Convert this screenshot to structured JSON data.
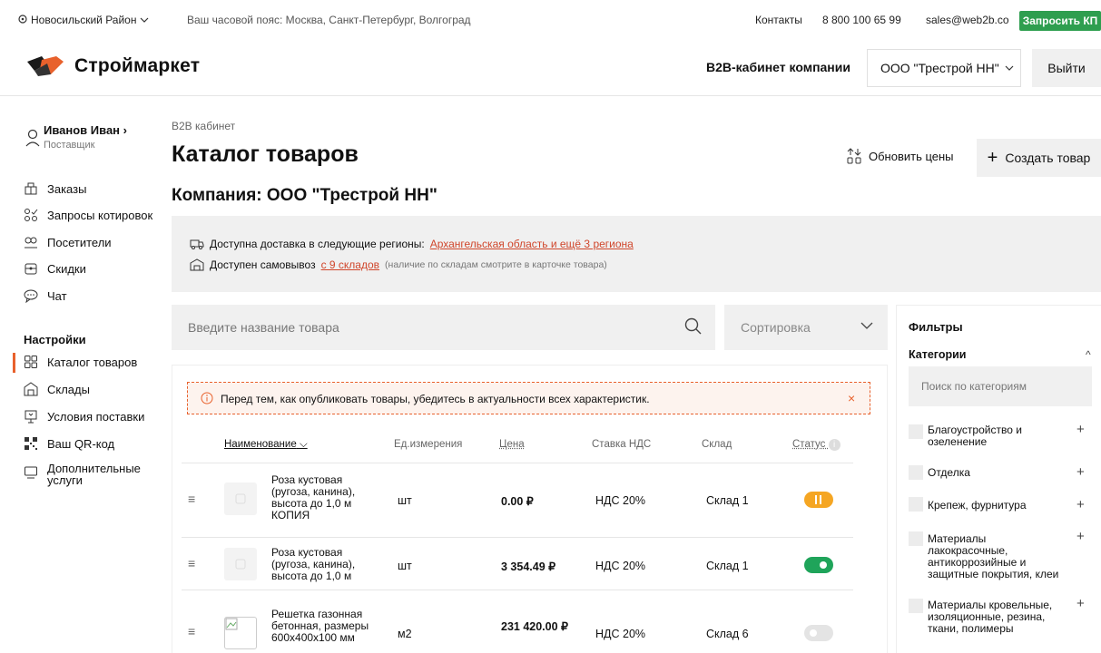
{
  "topbar": {
    "region": "Новосильский Район",
    "timezone": "Ваш часовой пояс: Москва, Санкт-Петербург, Волгоград",
    "contacts": "Контакты",
    "phone": "8 800 100 65 99",
    "email": "sales@web2b.co",
    "request_kp": "Запросить КП"
  },
  "header": {
    "logo_text": "Строймаркет",
    "b2b_label": "B2B-кабинет компании",
    "company_select": "ООО \"Трестрой НН\"",
    "logout": "Выйти"
  },
  "sidebar": {
    "user_name": "Иванов Иван",
    "user_role": "Поставщик",
    "items": [
      {
        "label": "Заказы",
        "icon": "orders-icon"
      },
      {
        "label": "Запросы котировок",
        "icon": "quotes-icon"
      },
      {
        "label": "Посетители",
        "icon": "visitors-icon"
      },
      {
        "label": "Скидки",
        "icon": "discount-icon"
      },
      {
        "label": "Чат",
        "icon": "chat-icon"
      }
    ],
    "settings_title": "Настройки",
    "settings_items": [
      {
        "label": "Каталог товаров",
        "icon": "catalog-icon",
        "active": true
      },
      {
        "label": "Склады",
        "icon": "warehouse-icon"
      },
      {
        "label": "Условия поставки",
        "icon": "delivery-terms-icon"
      },
      {
        "label": "Ваш QR-код",
        "icon": "qr-icon"
      },
      {
        "label": "Дополнительные услуги",
        "icon": "services-icon"
      }
    ]
  },
  "main": {
    "breadcrumb": "B2B кабинет",
    "title": "Каталог товаров",
    "company_title": "Компания: ООО \"Трестрой НН\"",
    "update_prices": "Обновить цены",
    "create_product": "Создать товар",
    "info": {
      "delivery_prefix": "Доступна доставка в следующие регионы:",
      "delivery_link": "Архангельская область и ещё 3 региона",
      "pickup_prefix": "Доступен самовывоз",
      "pickup_link": "с 9 складов",
      "pickup_note": "(наличие по складам смотрите в карточке товара)"
    },
    "search_placeholder": "Введите название товара",
    "sort_label": "Сортировка",
    "alert": "Перед тем, как опубликовать товары, убедитесь в актуальности всех характеристик.",
    "columns": {
      "name": "Наименование",
      "unit": "Ед.измерения",
      "price": "Цена",
      "vat": "Ставка НДС",
      "warehouse": "Склад",
      "status": "Статус"
    },
    "rows": [
      {
        "name": "Роза кустовая (ругоза, канина), высота до 1,0 м КОПИЯ",
        "unit": "шт",
        "price": "0.00 ₽",
        "vat": "НДС 20%",
        "warehouse": "Склад 1",
        "status": "paused"
      },
      {
        "name": "Роза кустовая (ругоза, канина), высота до 1,0 м",
        "unit": "шт",
        "price": "3 354.49 ₽",
        "vat": "НДС 20%",
        "warehouse": "Склад 1",
        "status": "on"
      },
      {
        "name": "Решетка газонная бетонная, размеры 600х400х100 мм",
        "unit": "м2",
        "price": "231 420.00 ₽",
        "vat": "НДС 20%",
        "warehouse": "Склад 6",
        "status": "off"
      }
    ]
  },
  "filters": {
    "title": "Фильтры",
    "categories_title": "Категории",
    "category_search_placeholder": "Поиск по категориям",
    "categories": [
      "Благоустройство и озеленение",
      "Отделка",
      "Крепеж, фурнитура",
      "Материалы лакокрасочные, антикоррозийные и защитные покрытия, клеи",
      "Материалы кровельные, изоляционные, резина, ткани, полимеры"
    ]
  },
  "colors": {
    "accent": "#e8612c",
    "success": "#1fa45a",
    "warning": "#f5a623",
    "kp_button": "#2e9e4f"
  }
}
